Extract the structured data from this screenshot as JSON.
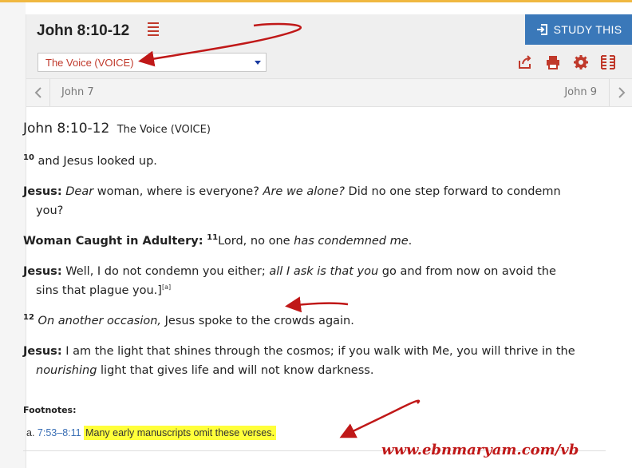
{
  "panel": {
    "title": "John 8:10-12",
    "study_label": "STUDY THIS"
  },
  "version_select": {
    "selected": "The Voice (VOICE)"
  },
  "nav": {
    "prev": "John 7",
    "next": "John 9"
  },
  "passage": {
    "heading": "John 8:10-12",
    "version": "The Voice (VOICE)",
    "p1": {
      "num": "10",
      "text": "and Jesus looked up."
    },
    "p2": {
      "speaker": "Jesus:",
      "i1": "Dear",
      "t1": " woman, where is everyone? ",
      "i2": "Are we alone?",
      "t2": " Did no one step forward to condemn you?"
    },
    "p3": {
      "speaker": "Woman Caught in Adultery:",
      "num": "11",
      "t1": "Lord, no one ",
      "i1": "has condemned me",
      "t2": "."
    },
    "p4": {
      "speaker": "Jesus:",
      "t1": " Well, I do not condemn you either; ",
      "i1": "all I ask is that you",
      "t2": " go and from now on avoid the sins that plague you.]",
      "fn": "[a]"
    },
    "p5": {
      "num": "12",
      "i1": "On another occasion,",
      "t1": " Jesus spoke to the crowds again."
    },
    "p6": {
      "speaker": "Jesus:",
      "t1": " I am the light that shines through the cosmos; if you walk with Me, you will thrive in the ",
      "i1": "nourishing",
      "t2": " light that gives life and will not know darkness."
    }
  },
  "footnotes": {
    "title": "Footnotes:",
    "items": [
      {
        "letter": "a.",
        "ref": "7:53–8:11",
        "text": "Many early manuscripts omit these verses."
      }
    ]
  },
  "watermark": "www.ebnmaryam.com/vb",
  "colors": {
    "accent_red": "#c0392b",
    "study_blue": "#3a78b9",
    "highlight": "#ffff3a",
    "arrow": "#c01818"
  },
  "icons": [
    "menu-icon",
    "study-enter-icon",
    "share-icon",
    "print-icon",
    "gear-icon",
    "parallel-icon",
    "chevron-left-icon",
    "chevron-right-icon"
  ]
}
